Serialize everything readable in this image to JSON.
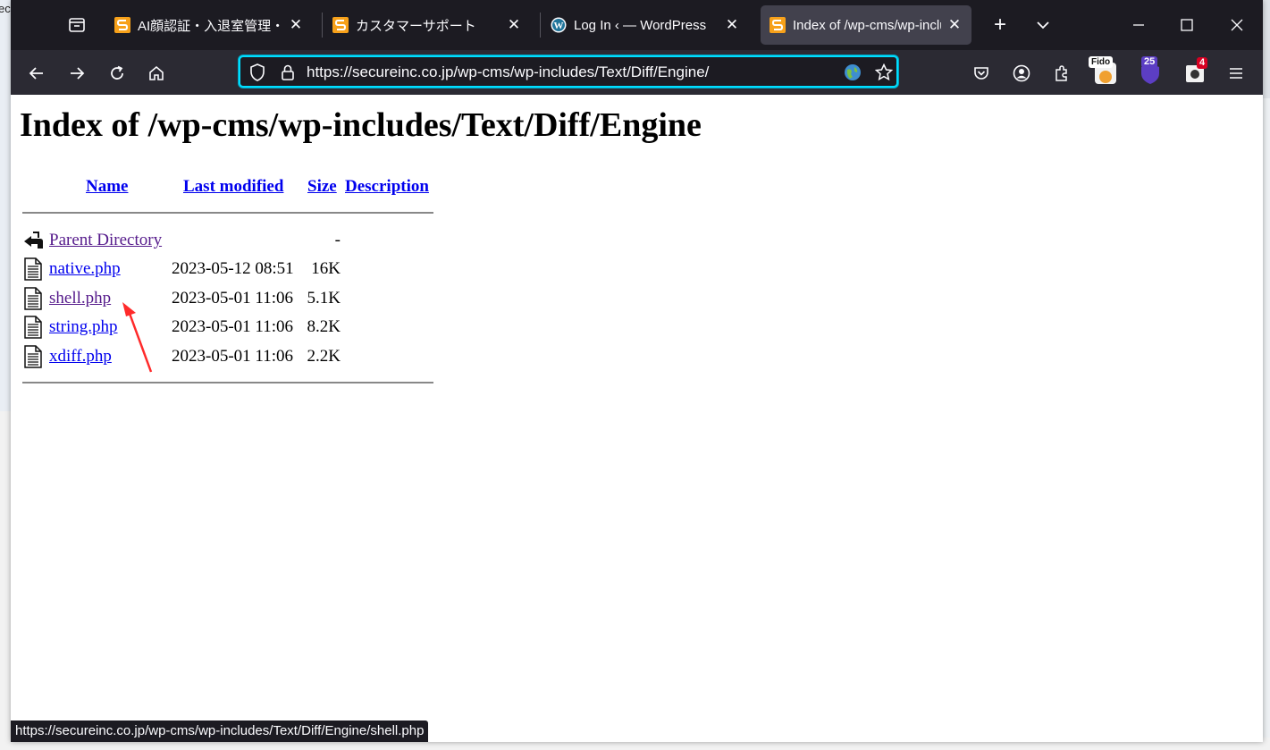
{
  "background": {
    "left_text": "ec"
  },
  "tabs": [
    {
      "title": "AI顔認証・入退室管理・勤",
      "favicon": "orange-s-icon",
      "active": false
    },
    {
      "title": "カスタマーサポート",
      "favicon": "orange-s-icon",
      "active": false
    },
    {
      "title": "Log In ‹ — WordPress",
      "favicon": "wordpress-icon",
      "active": false
    },
    {
      "title": "Index of /wp-cms/wp-includes",
      "favicon": "orange-s-icon",
      "active": true
    }
  ],
  "toolbar": {
    "url": "https://secureinc.co.jp/wp-cms/wp-includes/Text/Diff/Engine/",
    "extensions": {
      "fido_label": "Fido",
      "badge_25": "25",
      "badge_4": "4"
    }
  },
  "page": {
    "heading": "Index of /wp-cms/wp-includes/Text/Diff/Engine",
    "columns": {
      "name": "Name",
      "last_modified": "Last modified",
      "size": "Size",
      "description": "Description"
    },
    "rows": [
      {
        "name": "Parent Directory",
        "modified": "",
        "size": "-",
        "icon": "back-folder-icon",
        "visited": true
      },
      {
        "name": "native.php",
        "modified": "2023-05-12 08:51",
        "size": "16K",
        "icon": "file-icon",
        "visited": false
      },
      {
        "name": "shell.php",
        "modified": "2023-05-01 11:06",
        "size": "5.1K",
        "icon": "file-icon",
        "visited": true
      },
      {
        "name": "string.php",
        "modified": "2023-05-01 11:06",
        "size": "8.2K",
        "icon": "file-icon",
        "visited": false
      },
      {
        "name": "xdiff.php",
        "modified": "2023-05-01 11:06",
        "size": "2.2K",
        "icon": "file-icon",
        "visited": false
      }
    ]
  },
  "status": {
    "text": "https://secureinc.co.jp/wp-cms/wp-includes/Text/Diff/Engine/shell.php"
  },
  "colors": {
    "accent": "#00ddff",
    "link": "#0000ee",
    "visited": "#551a8b",
    "annotation": "#ff2a2a"
  }
}
